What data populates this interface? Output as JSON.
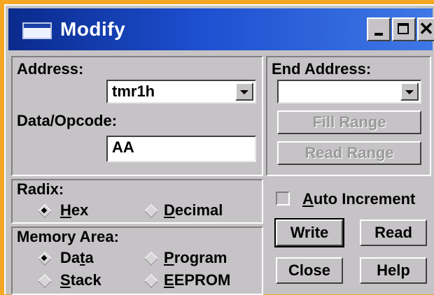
{
  "window": {
    "title": "Modify"
  },
  "address": {
    "label_prefix": "Address:",
    "value": "tmr1h"
  },
  "data_opcode": {
    "label": "Data/Opcode:",
    "value": "AA"
  },
  "end_address": {
    "label": "End Address:",
    "value": ""
  },
  "buttons": {
    "fill_range": "Fill Range",
    "read_range": "Read Range",
    "write": "Write",
    "read": "Read",
    "close": "Close",
    "help": "Help"
  },
  "radix": {
    "label": "Radix:",
    "hex_hot": "H",
    "hex_rest": "ex",
    "decimal_hot": "D",
    "decimal_rest": "ecimal",
    "selected": "Hex"
  },
  "auto_increment": {
    "hot": "A",
    "rest": "uto Increment",
    "checked": false
  },
  "memory_area": {
    "label": "Memory Area:",
    "data_pre": "Da",
    "data_hot": "t",
    "data_post": "a",
    "program_hot": "P",
    "program_rest": "rogram",
    "stack_hot": "S",
    "stack_rest": "tack",
    "eeprom_hot": "E",
    "eeprom_rest": "EPROM",
    "selected": "Data"
  }
}
